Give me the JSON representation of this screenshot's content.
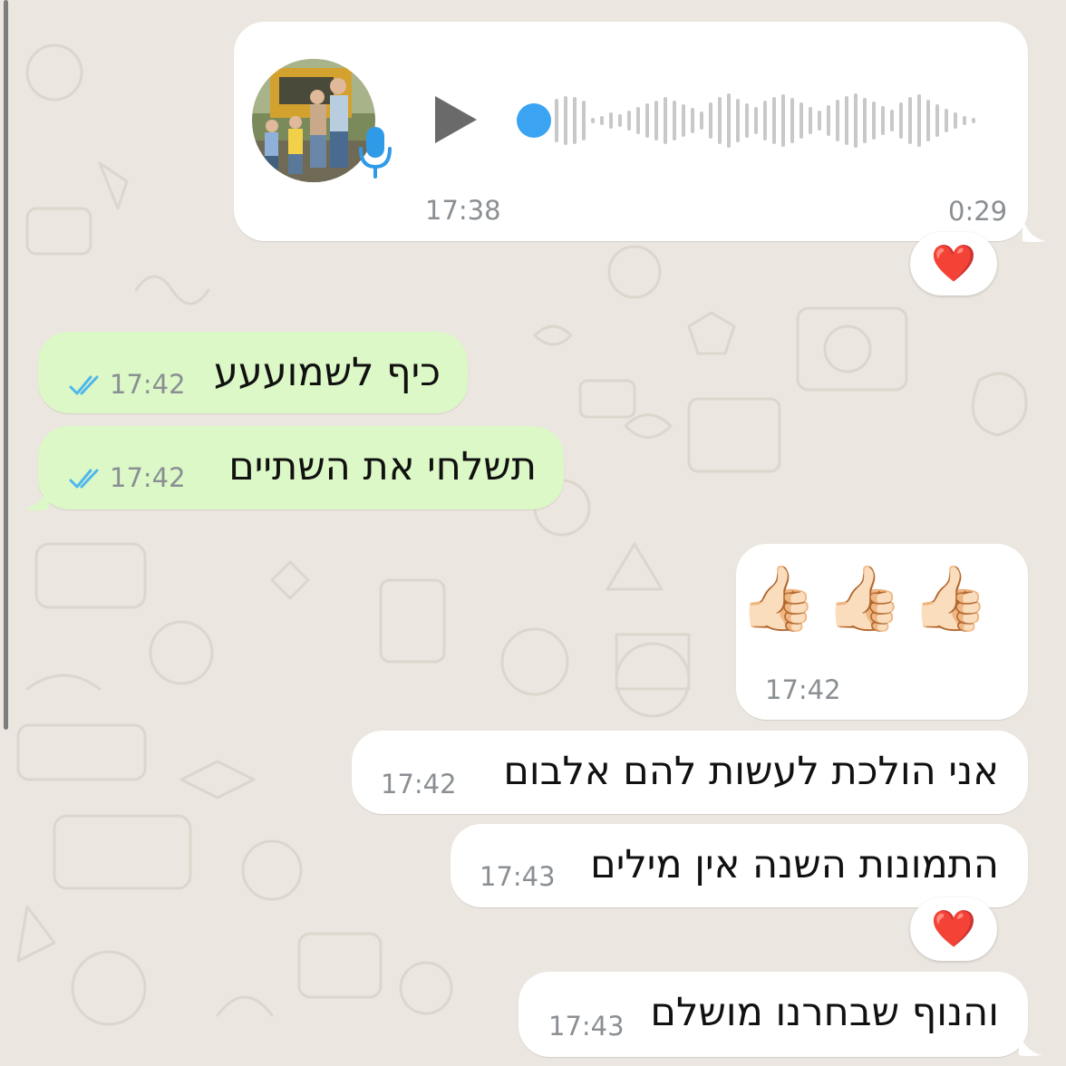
{
  "voice_message": {
    "time": "17:38",
    "duration": "0:29",
    "reaction": "❤️",
    "avatar_icon": "family-photo",
    "mic_icon": "microphone-icon",
    "play_icon": "play-icon"
  },
  "messages": [
    {
      "text": "כיף לשמועעע",
      "time": "17:42",
      "direction": "outgoing",
      "status": "read"
    },
    {
      "text": "תשלחי את השתיים",
      "time": "17:42",
      "direction": "outgoing",
      "status": "read"
    },
    {
      "text": "👍🏻👍🏻👍🏻",
      "time": "17:42",
      "direction": "incoming"
    },
    {
      "text": "אני הולכת לעשות להם אלבום",
      "time": "17:42",
      "direction": "incoming"
    },
    {
      "text": "התמונות השנה אין מילים",
      "time": "17:43",
      "direction": "incoming",
      "reaction": "❤️"
    },
    {
      "text": "והנוף שבחרנו מושלם",
      "time": "17:43",
      "direction": "incoming"
    }
  ],
  "colors": {
    "chat_background": "#ebe6df",
    "incoming_bubble": "#ffffff",
    "outgoing_bubble": "#dcf8c6",
    "read_ticks": "#4fb6ec",
    "waveform": "#c8c8c8",
    "playhead": "#3aa4f2"
  }
}
